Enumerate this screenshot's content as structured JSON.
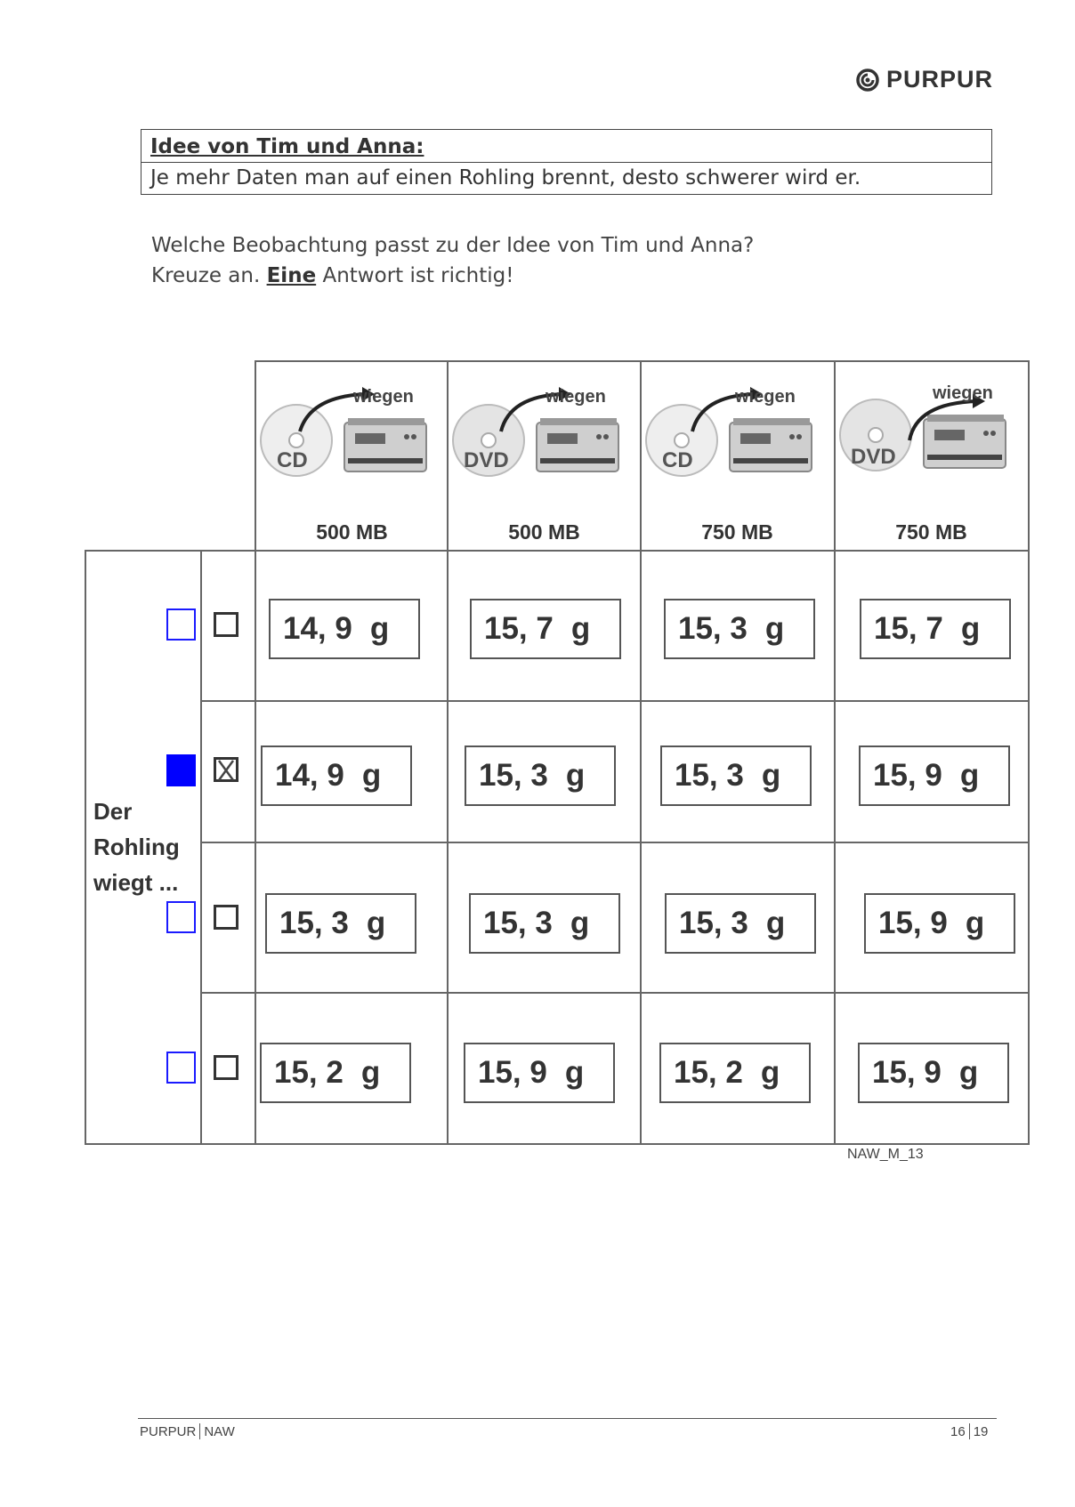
{
  "brand": {
    "name": "PURPUR",
    "icon": "purpur-spiral-logo"
  },
  "idea": {
    "title": "Idee von Tim und Anna:",
    "text": "Je mehr Daten man auf einen Rohling brennt, desto schwerer wird er."
  },
  "question": {
    "line1": "Welche Beobachtung passt zu der Idee von Tim und Anna?",
    "line2_pre": "Kreuze an. ",
    "line2_bold": "Eine",
    "line2_post": " Antwort ist richtig!"
  },
  "columns": [
    {
      "disc": "CD",
      "action": "wiegen",
      "size": "500 MB"
    },
    {
      "disc": "DVD",
      "action": "wiegen",
      "size": "500 MB"
    },
    {
      "disc": "CD",
      "action": "wiegen",
      "size": "750 MB"
    },
    {
      "disc": "DVD",
      "action": "wiegen",
      "size": "750 MB"
    }
  ],
  "row_label": [
    "Der",
    "Rohling",
    "wiegt ..."
  ],
  "rows": [
    {
      "selected": false,
      "crossed": false,
      "values": [
        "14, 9",
        "15, 7",
        "15, 3",
        "15, 7"
      ]
    },
    {
      "selected": true,
      "crossed": true,
      "values": [
        "14, 9",
        "15, 3",
        "15, 3",
        "15, 9"
      ]
    },
    {
      "selected": false,
      "crossed": false,
      "values": [
        "15, 3",
        "15, 3",
        "15, 3",
        "15, 9"
      ]
    },
    {
      "selected": false,
      "crossed": false,
      "values": [
        "15, 2",
        "15, 9",
        "15, 2",
        "15, 9"
      ]
    }
  ],
  "unit": "g",
  "code": "NAW_M_13",
  "footer": {
    "left_a": "PURPUR",
    "left_b": "NAW",
    "page": "16",
    "total": "19"
  },
  "colors": {
    "selection": "#0000ff",
    "text": "#333333"
  }
}
